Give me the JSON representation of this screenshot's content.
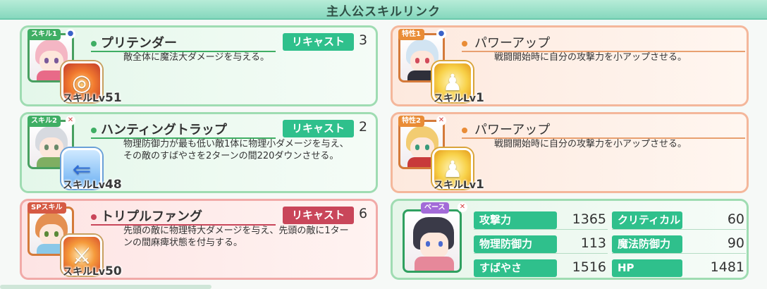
{
  "title": "主人公スキルリンク",
  "skills": [
    {
      "tag": "スキル1",
      "name": "プリテンダー",
      "recast_label": "リキャスト",
      "recast_value": "3",
      "description": "敵全体に魔法大ダメージを与える。",
      "level_prefix": "スキルLv",
      "level_value": "51",
      "icon": "fire-shield-icon"
    },
    {
      "tag": "スキル2",
      "name": "ハンティングトラップ",
      "recast_label": "リキャスト",
      "recast_value": "2",
      "description_line1": "物理防御力が最も低い敵1体に物理小ダメージを与え、",
      "description_line2": "その敵のすばやさを2ターンの間220ダウンさせる。",
      "level_prefix": "スキルLv",
      "level_value": "48",
      "icon": "speed-down-icon"
    },
    {
      "tag": "SPスキル",
      "name": "トリプルファング",
      "recast_label": "リキャスト",
      "recast_value": "6",
      "description_line1": "先頭の敵に物理特大ダメージを与え、先頭の敵に1ター",
      "description_line2": "ンの間麻痺状態を付与する。",
      "level_prefix": "スキルLv",
      "level_value": "50",
      "icon": "slash-icon"
    }
  ],
  "traits": [
    {
      "tag": "特性1",
      "name": "パワーアップ",
      "description": "戦闘開始時に自分の攻撃力を小アップさせる。",
      "level_prefix": "スキルLv",
      "level_value": "1",
      "icon": "power-up-icon"
    },
    {
      "tag": "特性2",
      "name": "パワーアップ",
      "description": "戦闘開始時に自分の攻撃力を小アップさせる。",
      "level_prefix": "スキルLv",
      "level_value": "1",
      "icon": "power-up-icon"
    }
  ],
  "base": {
    "tag": "ベース",
    "stats": [
      {
        "label": "攻撃力",
        "value": "1365"
      },
      {
        "label": "クリティカル",
        "value": "60"
      },
      {
        "label": "物理防御力",
        "value": "113"
      },
      {
        "label": "魔法防御力",
        "value": "90"
      },
      {
        "label": "すばやさ",
        "value": "1516"
      },
      {
        "label": "HP",
        "value": "1481"
      }
    ]
  },
  "colors": {
    "accent_green": "#2fc08c",
    "accent_red": "#c9465a",
    "title_bar": "#86d8be"
  }
}
